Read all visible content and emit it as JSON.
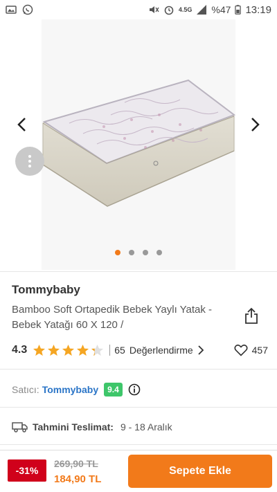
{
  "status_bar": {
    "battery_percent": "%47",
    "network": "4.5G",
    "time": "13:19"
  },
  "carousel": {
    "image_label": "mattress-photo",
    "page_count": 4,
    "active_page": 1
  },
  "product": {
    "brand": "Tommybaby",
    "title": "Bamboo Soft Ortapedik Bebek Yaylı Yatak - Bebek Yatağı 60 X 120 /",
    "rating": "4.3",
    "rating_value": 4.3,
    "rating_max": 5,
    "review_count": "65",
    "review_label": "Değerlendirme",
    "favorites": "457"
  },
  "seller": {
    "label": "Satıcı:",
    "name": "Tommybaby",
    "score": "9.4"
  },
  "delivery": {
    "label": "Tahmini Teslimat:",
    "value": "9 - 18 Aralık"
  },
  "bottom_bar": {
    "discount": "-31%",
    "old_price": "269,90 TL",
    "new_price": "184,90 TL",
    "cart_button": "Sepete Ekle"
  },
  "colors": {
    "accent": "#f27a1a",
    "discount": "#d0011b",
    "seller_link": "#2b75c7",
    "score_badge": "#3ec66a",
    "star": "#f5a623"
  }
}
